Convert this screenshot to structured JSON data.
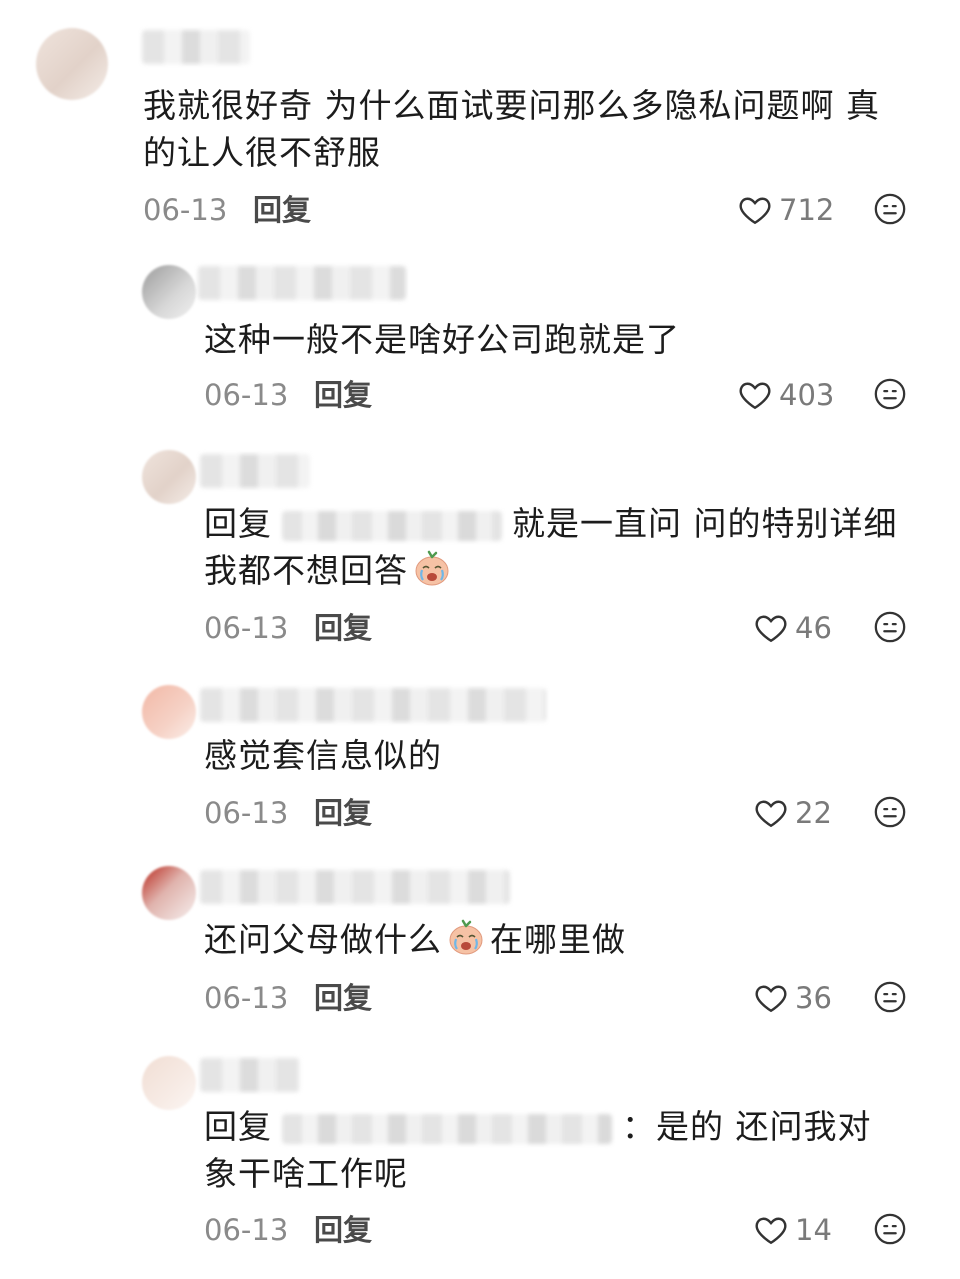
{
  "comments": [
    {
      "text": "我就很好奇 为什么面试要问那么多隐私问题啊 真的让人很不舒服",
      "date": "06-13",
      "reply": "回复",
      "likes": "712"
    },
    {
      "text": "这种一般不是啥好公司跑就是了",
      "date": "06-13",
      "reply": "回复",
      "likes": "403"
    },
    {
      "prefix": "回复",
      "text": "就是一直问 问的特别详细 我都不想回答",
      "date": "06-13",
      "reply": "回复",
      "likes": "46",
      "emoji": "crying-face-emoji"
    },
    {
      "text": "感觉套信息似的",
      "date": "06-13",
      "reply": "回复",
      "likes": "22"
    },
    {
      "text_a": "还问父母做什么",
      "text_b": "在哪里做",
      "date": "06-13",
      "reply": "回复",
      "likes": "36",
      "emoji": "crying-face-emoji"
    },
    {
      "prefix": "回复",
      "text": "：是的 还问我对象干啥工作呢",
      "date": "06-13",
      "reply": "回复",
      "likes": "14"
    }
  ],
  "icons": {
    "like": "heart-outline-icon",
    "dislike": "meh-face-icon"
  },
  "colors": {
    "text": "#1c1c1c",
    "meta": "#8a8a8a",
    "reply_btn": "#4a4a4a"
  }
}
